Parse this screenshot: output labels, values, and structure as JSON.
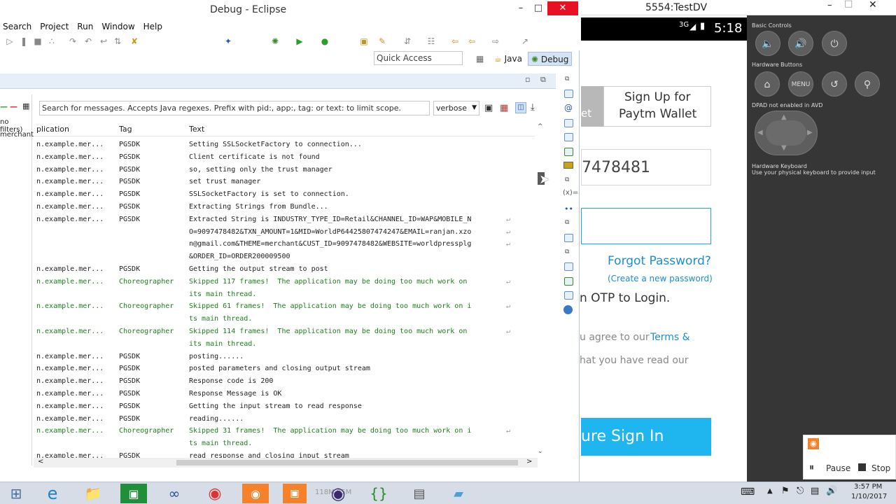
{
  "eclipse": {
    "title": "Debug - Eclipse",
    "menu": [
      "Search",
      "Project",
      "Run",
      "Window",
      "Help"
    ],
    "quick_access": "Quick Access",
    "perspectives": [
      "Java",
      "Debug"
    ],
    "logcat": {
      "search_placeholder": "Search for messages. Accepts Java regexes. Prefix with pid:, app:, tag: or text: to limit scope.",
      "level": "verbose",
      "left_filters": [
        "no filters)",
        "merchant"
      ],
      "columns": [
        "plication",
        "Tag",
        "Text"
      ],
      "rows": [
        {
          "app": "n.example.mer...",
          "tag": "PGSDK",
          "text": "Setting SSLSocketFactory to connection...",
          "green": false,
          "wrap": false
        },
        {
          "app": "n.example.mer...",
          "tag": "PGSDK",
          "text": "Client certificate is not found",
          "green": false,
          "wrap": false
        },
        {
          "app": "n.example.mer...",
          "tag": "PGSDK",
          "text": "so, setting only the trust manager",
          "green": false,
          "wrap": false
        },
        {
          "app": "n.example.mer...",
          "tag": "PGSDK",
          "text": "set trust manager",
          "green": false,
          "wrap": false
        },
        {
          "app": "n.example.mer...",
          "tag": "PGSDK",
          "text": "SSLSocketFactory is set to connection.",
          "green": false,
          "wrap": false
        },
        {
          "app": "n.example.mer...",
          "tag": "PGSDK",
          "text": "Extracting Strings from Bundle...",
          "green": false,
          "wrap": false
        },
        {
          "app": "n.example.mer...",
          "tag": "PGSDK",
          "text": "Extracted String is INDUSTRY_TYPE_ID=Retail&CHANNEL_ID=WAP&MOBILE_N",
          "green": false,
          "wrap": true
        },
        {
          "app": "",
          "tag": "",
          "text": "O=9097478482&TXN_AMOUNT=1&MID=WorldP64425807474247&EMAIL=ranjan.xzo",
          "green": false,
          "wrap": true
        },
        {
          "app": "",
          "tag": "",
          "text": "n@gmail.com&THEME=merchant&CUST_ID=9097478482&WEBSITE=worldpressplg",
          "green": false,
          "wrap": true
        },
        {
          "app": "",
          "tag": "",
          "text": "&ORDER_ID=ORDER200009500",
          "green": false,
          "wrap": false
        },
        {
          "app": "n.example.mer...",
          "tag": "PGSDK",
          "text": "Getting the output stream to post",
          "green": false,
          "wrap": false
        },
        {
          "app": "n.example.mer...",
          "tag": "Choreographer",
          "text": "Skipped 117 frames!  The application may be doing too much work on",
          "green": true,
          "wrap": true
        },
        {
          "app": "",
          "tag": "",
          "text": "its main thread.",
          "green": true,
          "wrap": false
        },
        {
          "app": "n.example.mer...",
          "tag": "Choreographer",
          "text": "Skipped 61 frames!  The application may be doing too much work on i",
          "green": true,
          "wrap": true
        },
        {
          "app": "",
          "tag": "",
          "text": "ts main thread.",
          "green": true,
          "wrap": false
        },
        {
          "app": "n.example.mer...",
          "tag": "Choreographer",
          "text": "Skipped 114 frames!  The application may be doing too much work on",
          "green": true,
          "wrap": true
        },
        {
          "app": "",
          "tag": "",
          "text": "its main thread.",
          "green": true,
          "wrap": false
        },
        {
          "app": "n.example.mer...",
          "tag": "PGSDK",
          "text": "posting......",
          "green": false,
          "wrap": false
        },
        {
          "app": "n.example.mer...",
          "tag": "PGSDK",
          "text": "posted parameters and closing output stream",
          "green": false,
          "wrap": false
        },
        {
          "app": "n.example.mer...",
          "tag": "PGSDK",
          "text": "Response code is 200",
          "green": false,
          "wrap": false
        },
        {
          "app": "n.example.mer...",
          "tag": "PGSDK",
          "text": "Response Message is OK",
          "green": false,
          "wrap": false
        },
        {
          "app": "n.example.mer...",
          "tag": "PGSDK",
          "text": "Getting the input stream to read response",
          "green": false,
          "wrap": false
        },
        {
          "app": "n.example.mer...",
          "tag": "PGSDK",
          "text": "reading......",
          "green": false,
          "wrap": false
        },
        {
          "app": "n.example.mer...",
          "tag": "Choreographer",
          "text": "Skipped 31 frames!  The application may be doing too much work on i",
          "green": true,
          "wrap": true
        },
        {
          "app": "",
          "tag": "",
          "text": "ts main thread.",
          "green": true,
          "wrap": false
        },
        {
          "app": "n.example.mer...",
          "tag": "PGSDK",
          "text": "read response and closing input stream",
          "green": false,
          "wrap": false
        }
      ]
    }
  },
  "emulator": {
    "title": "5554:TestDV",
    "status_time": "5:18",
    "network": "3G",
    "app": {
      "signup_line1": "Sign Up for",
      "signup_line2": "Paytm Wallet",
      "tab_fragment": "et",
      "phone_fragment": "7478481",
      "forgot_password": "Forgot Password?",
      "create_password": "(Create a new password)",
      "otp_text": "n OTP to Login.",
      "agree_text": "u agree to our",
      "terms": "Terms &",
      "read_text": "hat you have read our",
      "signin": "ure Sign In"
    },
    "panel": {
      "basic_controls": "Basic Controls",
      "hardware_buttons": "Hardware Buttons",
      "dpad": "DPAD not enabled in AVD",
      "keyboard_title": "Hardware Keyboard",
      "keyboard_sub": "Use your physical keyboard to provide input",
      "menu_label": "MENU"
    }
  },
  "recorder": {
    "pause": "Pause",
    "stop": "Stop"
  },
  "taskbar": {
    "time": "3:57 PM",
    "date": "1/10/2017",
    "dim_text": "118M 95M"
  },
  "colors": {
    "accent": "#1fb6ef",
    "close": "#e81123",
    "log_green": "#1d7f1d",
    "link": "#1a8fd1"
  }
}
